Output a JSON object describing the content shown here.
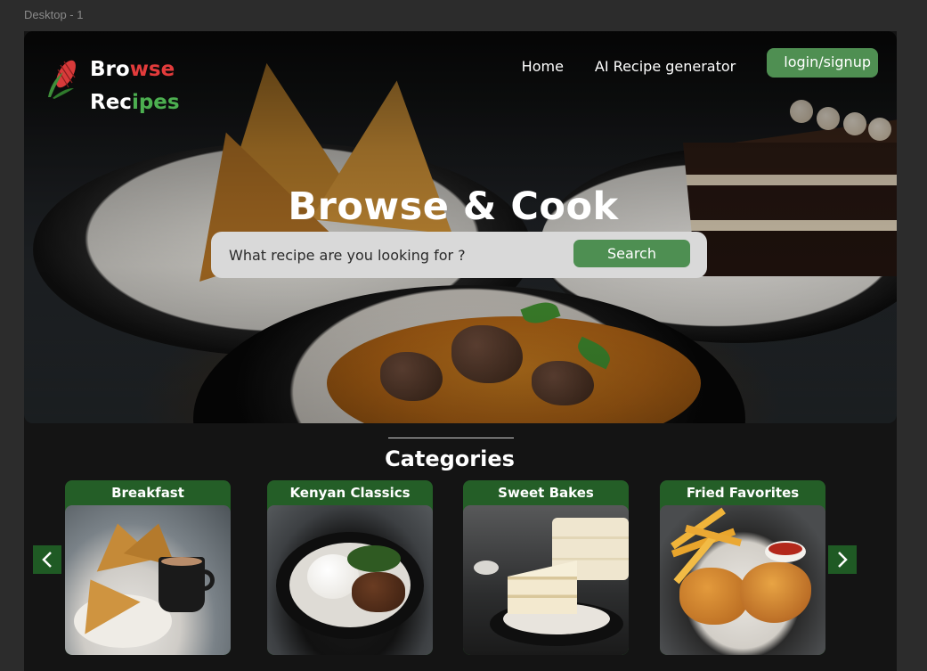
{
  "frame_label": "Desktop - 1",
  "brand": {
    "line1_part1": "Bro",
    "line1_part2": "wse",
    "line2_part1": "Rec",
    "line2_part2": "ipes",
    "icon": "corn-icon",
    "red": "#e23b3b",
    "green": "#4caf50"
  },
  "nav": {
    "home": "Home",
    "ai_generator": "AI Recipe generator",
    "login": "login/signup"
  },
  "hero": {
    "title": "Browse & Cook",
    "search_placeholder": "What recipe are you looking for ?",
    "search_button": "Search"
  },
  "categories": {
    "title": "Categories",
    "prev_icon": "chevron-left-icon",
    "next_icon": "chevron-right-icon",
    "items": [
      {
        "label": "Breakfast"
      },
      {
        "label": "Kenyan Classics"
      },
      {
        "label": "Sweet Bakes"
      },
      {
        "label": "Fried Favorites"
      }
    ]
  },
  "colors": {
    "accent_green": "#4e8f52",
    "dark_green": "#245e27",
    "background": "#141414"
  }
}
